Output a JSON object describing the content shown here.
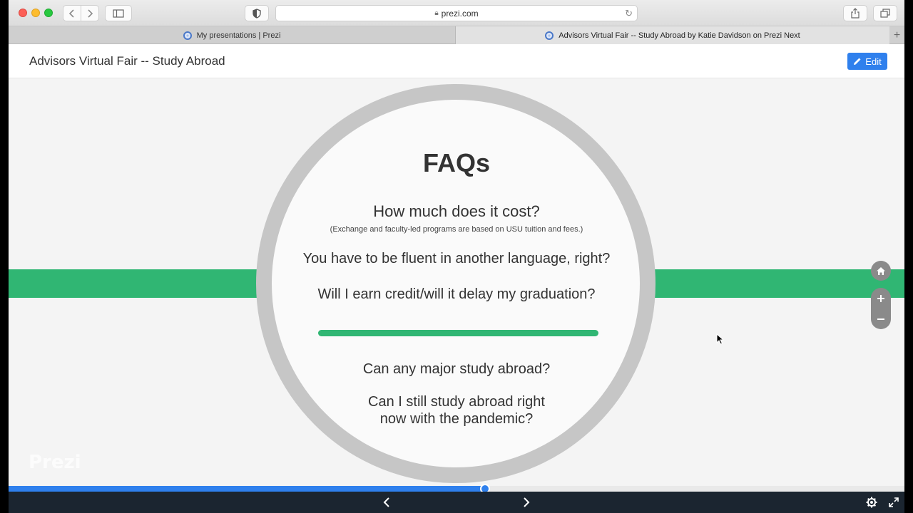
{
  "browser": {
    "url": "prezi.com",
    "tabs": [
      {
        "label": "My presentations | Prezi"
      },
      {
        "label": "Advisors Virtual Fair -- Study Abroad by Katie Davidson on Prezi Next"
      }
    ]
  },
  "header": {
    "title": "Advisors Virtual Fair -- Study Abroad",
    "edit_label": "Edit"
  },
  "slide": {
    "title": "FAQs",
    "question_1": "How much does it cost?",
    "question_1_note": "(Exchange and faculty-led programs are based on USU tuition and fees.)",
    "question_2": "You have to be fluent in another language, right?",
    "question_3": "Will I earn credit/will it delay my graduation?",
    "question_4": "Can any major study abroad?",
    "question_5_line1": "Can I still study abroad right",
    "question_5_line2": "now with the pandemic?"
  },
  "watermark": "Prezi",
  "colors": {
    "accent_green": "#30b673",
    "accent_blue": "#2f80ed",
    "ring_gray": "#c6c6c6",
    "bottom_bar": "#1b2530"
  },
  "progress": {
    "fraction": 0.532
  },
  "icons": {
    "zoom_home": "home-icon",
    "zoom_in": "plus-icon",
    "zoom_out": "minus-icon",
    "prev": "chevron-left-icon",
    "next": "chevron-right-icon",
    "settings": "gear-icon",
    "fullscreen": "expand-icon"
  }
}
